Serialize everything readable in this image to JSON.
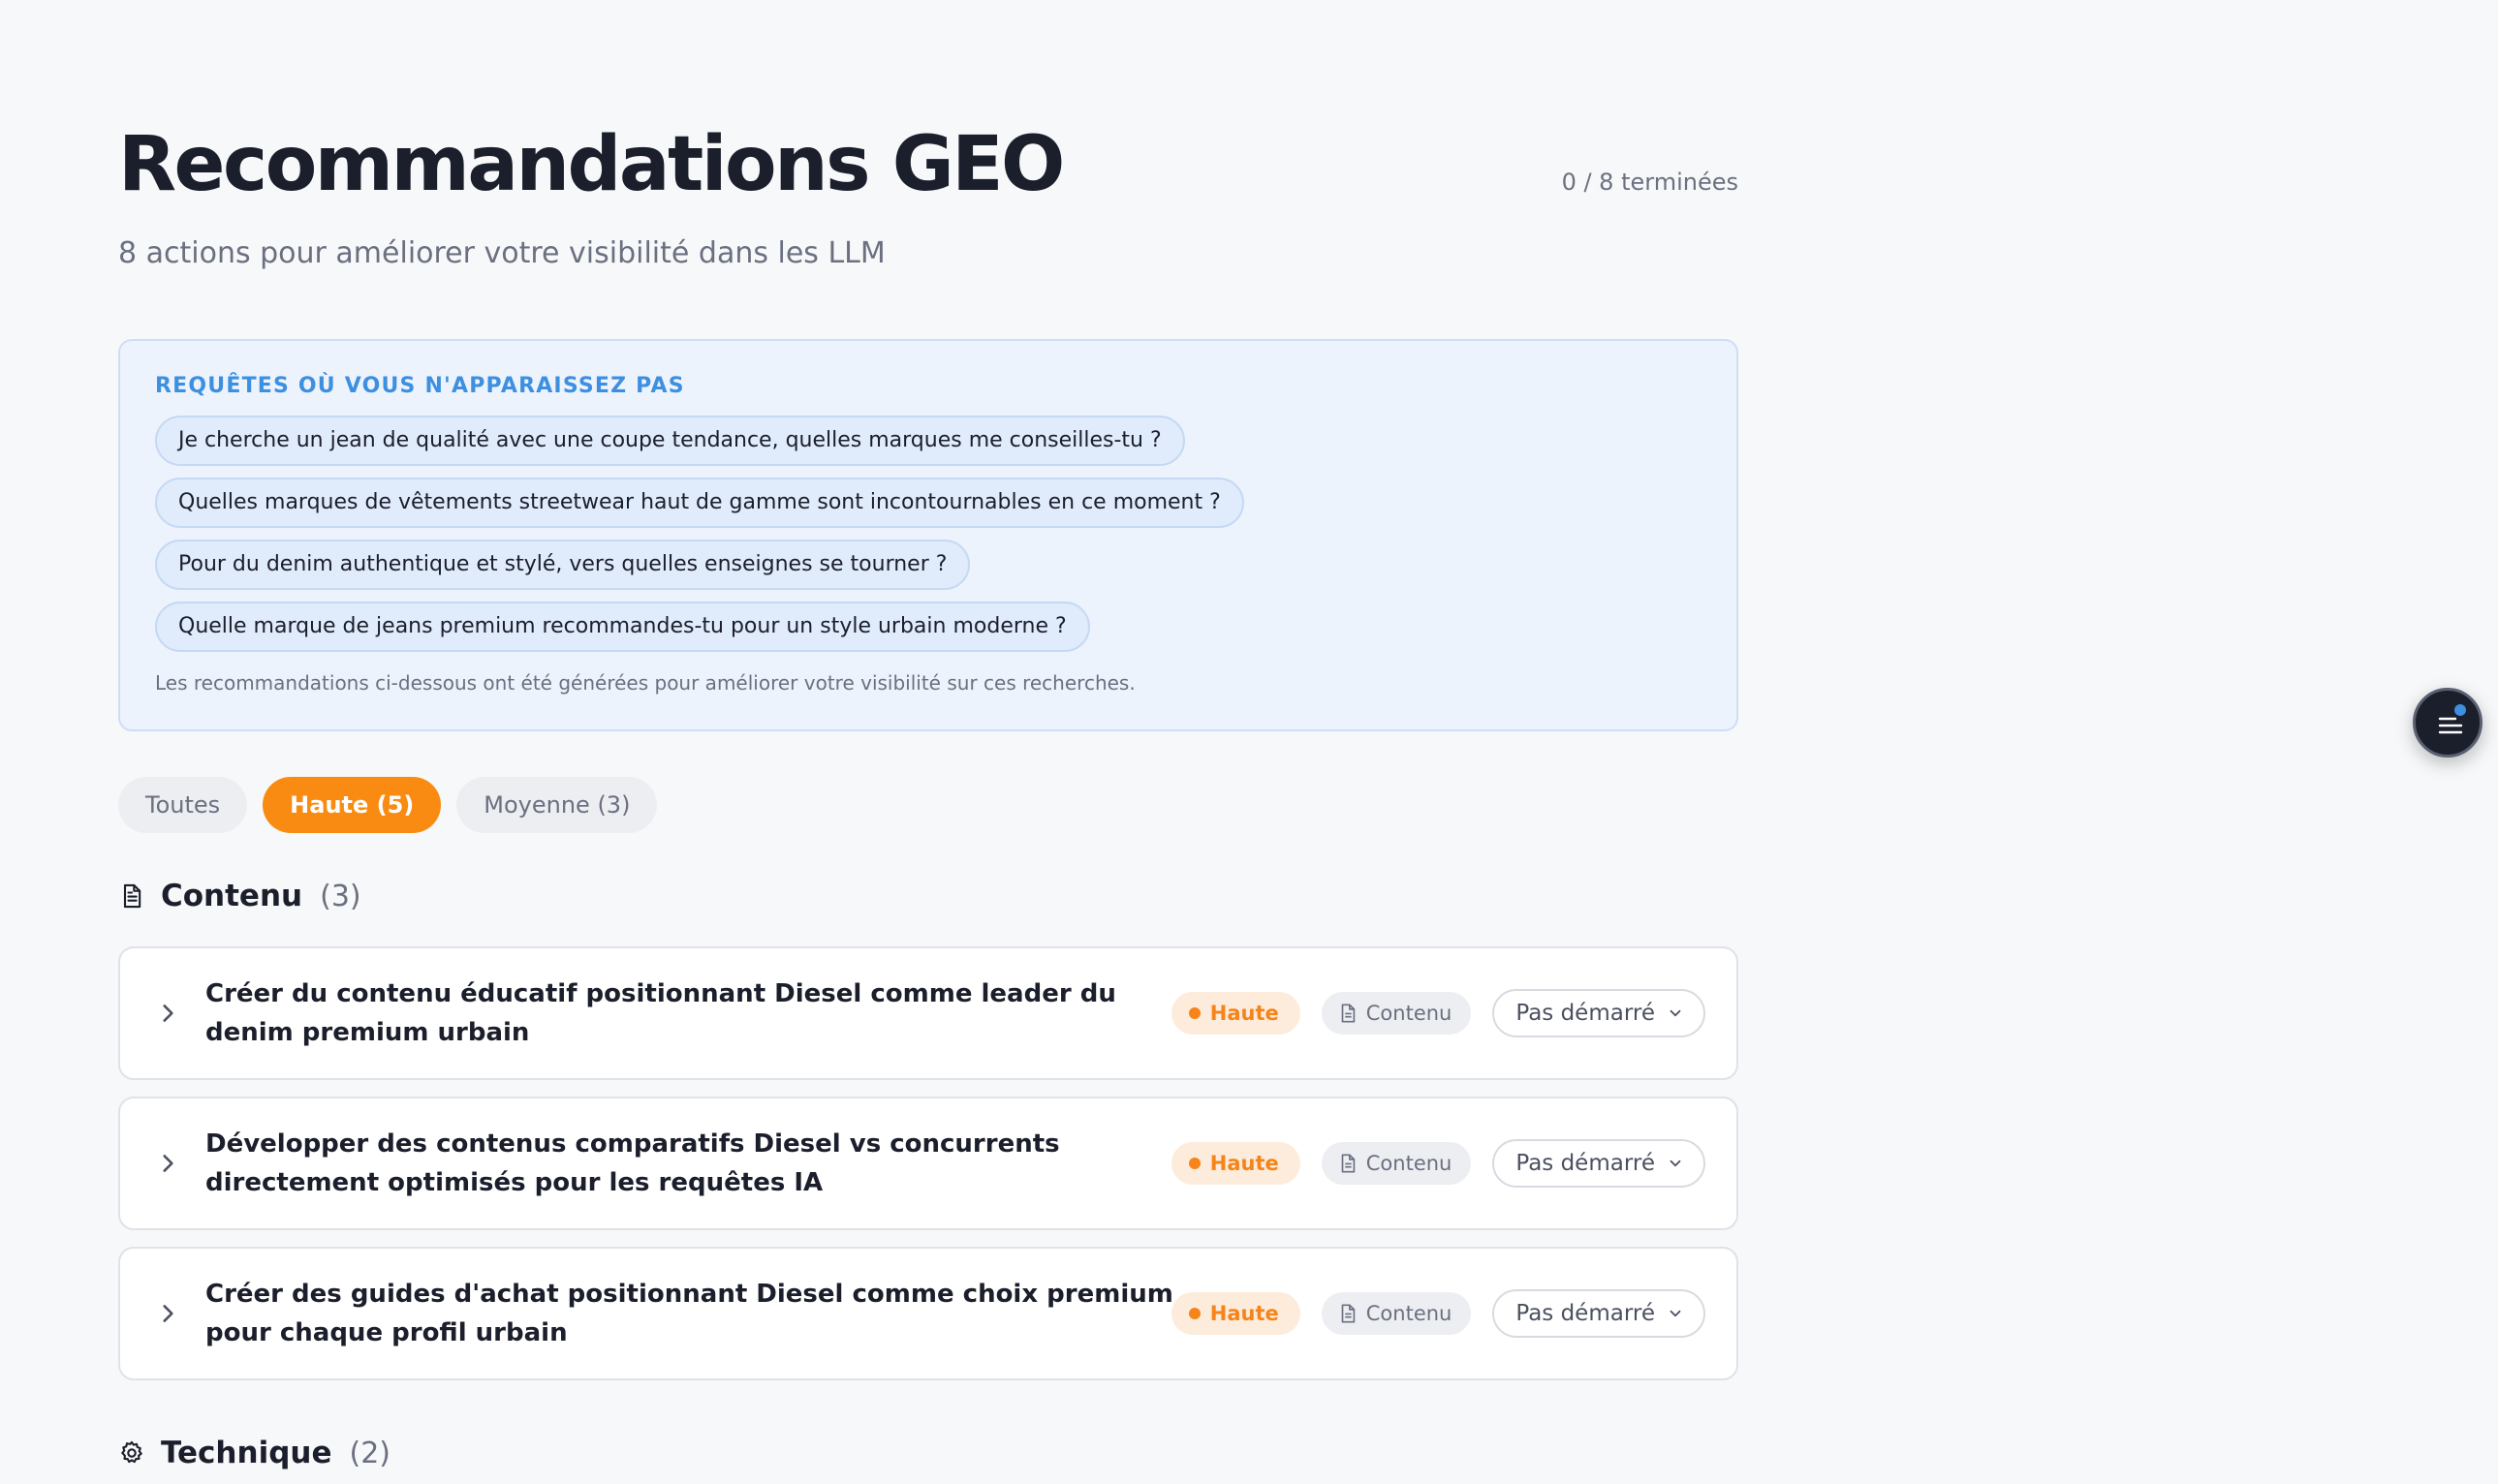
{
  "header": {
    "title": "Recommandations GEO",
    "subtitle": "8 actions pour améliorer votre visibilité dans les LLM",
    "progress": "0 / 8 terminées"
  },
  "queries": {
    "heading": "REQUÊTES OÙ VOUS N'APPARAISSEZ PAS",
    "items": [
      "Je cherche un jean de qualité avec une coupe tendance, quelles marques me conseilles-tu ?",
      "Quelles marques de vêtements streetwear haut de gamme sont incontournables en ce moment ?",
      "Pour du denim authentique et stylé, vers quelles enseignes se tourner ?",
      "Quelle marque de jeans premium recommandes-tu pour un style urbain moderne ?"
    ],
    "note": "Les recommandations ci-dessous ont été générées pour améliorer votre visibilité sur ces recherches."
  },
  "filters": {
    "all": "Toutes",
    "high": "Haute (5)",
    "medium": "Moyenne (3)",
    "active": "high"
  },
  "sections": {
    "content": {
      "name": "Contenu",
      "count": "(3)",
      "icon": "document-icon",
      "items": [
        {
          "title": "Créer du contenu éducatif positionnant Diesel comme leader du denim premium urbain",
          "priority": "Haute",
          "category": "Contenu",
          "status": "Pas démarré"
        },
        {
          "title": "Développer des contenus comparatifs Diesel vs concurrents directement optimisés pour les requêtes IA",
          "priority": "Haute",
          "category": "Contenu",
          "status": "Pas démarré"
        },
        {
          "title": "Créer des guides d'achat positionnant Diesel comme choix premium pour chaque profil urbain",
          "priority": "Haute",
          "category": "Contenu",
          "status": "Pas démarré"
        }
      ]
    },
    "technical": {
      "name": "Technique",
      "count": "(2)",
      "icon": "gear-icon"
    }
  },
  "colors": {
    "accent_orange": "#fa8b12",
    "query_blue": "#3d8fe0",
    "text_dark": "#1b1e2b",
    "text_muted": "#6b7080"
  }
}
